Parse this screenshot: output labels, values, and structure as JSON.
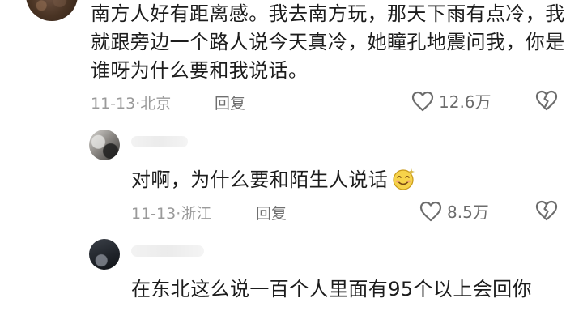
{
  "comments": [
    {
      "text": "南方人好有距离感。我去南方玩，那天下雨有点冷，我就跟旁边一个路人说今天真冷，她瞳孔地震问我，你是谁呀为什么要和我说话。",
      "date_location": "11-13·北京",
      "reply_label": "回复",
      "likes": "12.6万"
    },
    {
      "text": "对啊，为什么要和陌生人说话",
      "emoji": "smiling-face-emoji",
      "date_location": "11-13·浙江",
      "reply_label": "回复",
      "likes": "8.5万"
    },
    {
      "text": "在东北这么说一百个人里面有95个以上会回你"
    }
  ],
  "colors": {
    "text": "#1c1c1c",
    "meta": "#9a9a9a",
    "icon": "#6c6c6c"
  }
}
